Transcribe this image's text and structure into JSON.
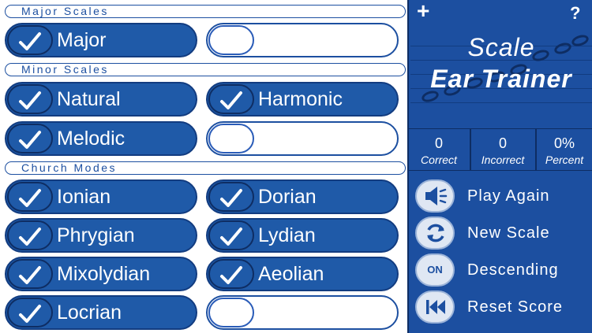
{
  "sections": {
    "major": "Major Scales",
    "minor": "Minor Scales",
    "church": "Church Modes"
  },
  "scales": {
    "major": [
      {
        "label": "Major",
        "on": true
      }
    ],
    "minor": [
      {
        "label": "Natural",
        "on": true
      },
      {
        "label": "Harmonic",
        "on": true
      },
      {
        "label": "Melodic",
        "on": true
      }
    ],
    "church": [
      {
        "label": "Ionian",
        "on": true
      },
      {
        "label": "Dorian",
        "on": true
      },
      {
        "label": "Phrygian",
        "on": true
      },
      {
        "label": "Lydian",
        "on": true
      },
      {
        "label": "Mixolydian",
        "on": true
      },
      {
        "label": "Aeolian",
        "on": true
      },
      {
        "label": "Locrian",
        "on": true
      }
    ]
  },
  "app": {
    "add_symbol": "+",
    "help_symbol": "?",
    "title_line1": "Scale",
    "title_line2": "Ear Trainer"
  },
  "stats": {
    "correct_value": "0",
    "correct_label": "Correct",
    "incorrect_value": "0",
    "incorrect_label": "Incorrect",
    "percent_value": "0%",
    "percent_label": "Percent"
  },
  "actions": {
    "play_again": "Play Again",
    "new_scale": "New Scale",
    "descending_toggle": "ON",
    "descending": "Descending",
    "reset_score": "Reset Score"
  },
  "colors": {
    "accent": "#1c4fa0",
    "dark": "#0e2d63",
    "panel": "#1f5aa8"
  }
}
